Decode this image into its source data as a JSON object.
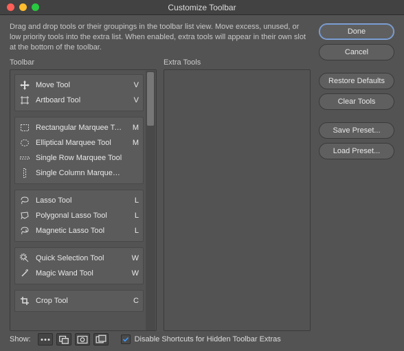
{
  "window": {
    "title": "Customize Toolbar"
  },
  "instructions": "Drag and drop tools or their groupings in the toolbar list view. Move excess, unused, or low priority tools into the extra list. When enabled, extra tools will appear in their own slot at the bottom of the toolbar.",
  "headers": {
    "toolbar": "Toolbar",
    "extra": "Extra Tools"
  },
  "groups": [
    {
      "tools": [
        {
          "icon": "move",
          "name": "Move Tool",
          "key": "V"
        },
        {
          "icon": "artboard",
          "name": "Artboard Tool",
          "key": "V"
        }
      ]
    },
    {
      "tools": [
        {
          "icon": "rect-marquee",
          "name": "Rectangular Marquee Tool",
          "key": "M"
        },
        {
          "icon": "ellipse-marquee",
          "name": "Elliptical Marquee Tool",
          "key": "M"
        },
        {
          "icon": "row-marquee",
          "name": "Single Row Marquee Tool",
          "key": ""
        },
        {
          "icon": "col-marquee",
          "name": "Single Column Marquee Tool",
          "key": ""
        }
      ]
    },
    {
      "tools": [
        {
          "icon": "lasso",
          "name": "Lasso Tool",
          "key": "L"
        },
        {
          "icon": "poly-lasso",
          "name": "Polygonal Lasso Tool",
          "key": "L"
        },
        {
          "icon": "mag-lasso",
          "name": "Magnetic Lasso Tool",
          "key": "L"
        }
      ]
    },
    {
      "tools": [
        {
          "icon": "quick-select",
          "name": "Quick Selection Tool",
          "key": "W"
        },
        {
          "icon": "magic-wand",
          "name": "Magic Wand Tool",
          "key": "W"
        }
      ]
    },
    {
      "tools": [
        {
          "icon": "crop",
          "name": "Crop Tool",
          "key": "C"
        }
      ]
    }
  ],
  "buttons": {
    "done": "Done",
    "cancel": "Cancel",
    "restore": "Restore Defaults",
    "clear": "Clear Tools",
    "save": "Save Preset...",
    "load": "Load Preset..."
  },
  "footer": {
    "show": "Show:",
    "disable": "Disable Shortcuts for Hidden Toolbar Extras",
    "disable_checked": true
  }
}
